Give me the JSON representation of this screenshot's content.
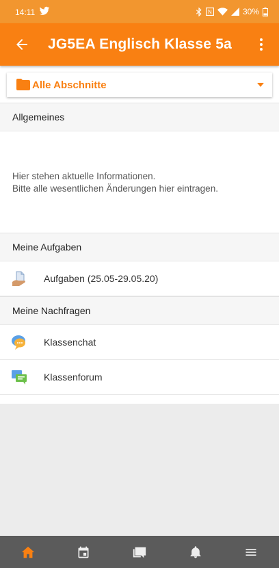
{
  "status_bar": {
    "time": "14:11",
    "battery": "30%"
  },
  "app_bar": {
    "title": "JG5EA Englisch Klasse 5a"
  },
  "section_selector": {
    "label": "Alle Abschnitte"
  },
  "sections": {
    "general": {
      "title": "Allgemeines",
      "summary_line1": "Hier stehen aktuelle Informationen.",
      "summary_line2": "Bitte alle wesentlichen Änderungen hier eintragen."
    },
    "tasks": {
      "title": "Meine Aufgaben",
      "items": [
        {
          "label": "Aufgaben (25.05-29.05.20)",
          "icon": "assignment-icon"
        }
      ]
    },
    "questions": {
      "title": "Meine Nachfragen",
      "items": [
        {
          "label": "Klassenchat",
          "icon": "chat-icon"
        },
        {
          "label": "Klassenforum",
          "icon": "forum-icon"
        }
      ]
    }
  },
  "tabs": [
    {
      "icon": "home-icon",
      "active": true
    },
    {
      "icon": "calendar-icon"
    },
    {
      "icon": "messages-icon"
    },
    {
      "icon": "notifications-icon"
    },
    {
      "icon": "menu-icon"
    }
  ],
  "colors": {
    "accent": "#f98012",
    "status": "#f2962f",
    "tabbar": "#5b5b5b"
  }
}
